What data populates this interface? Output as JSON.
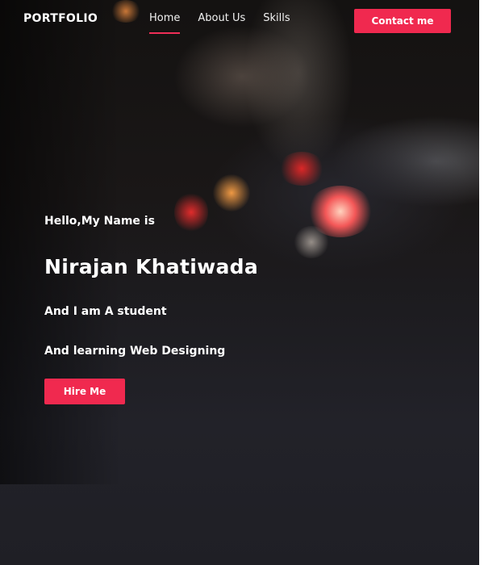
{
  "brand": {
    "logo_text": "PORTFOLIO"
  },
  "nav": {
    "links": [
      {
        "label": "Home",
        "active": true
      },
      {
        "label": "About Us",
        "active": false
      },
      {
        "label": "Skills",
        "active": false
      }
    ],
    "contact_label": "Contact me"
  },
  "hero": {
    "greeting": "Hello,My Name is",
    "name": "Nirajan Khatiwada",
    "line1": "And I am A student",
    "line2": "And learning Web Designing",
    "cta_label": "Hire Me"
  },
  "theme": {
    "accent": "#f0294f",
    "text": "#ffffff",
    "background": "#1b1a1d"
  }
}
